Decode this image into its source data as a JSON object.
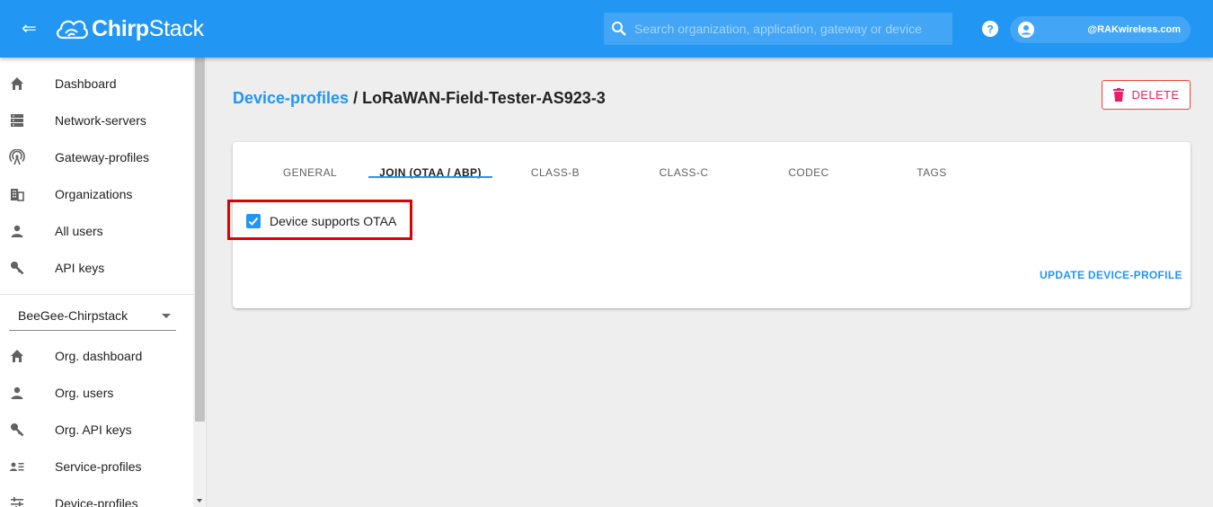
{
  "app": {
    "menu_icon": "collapse-menu-icon",
    "logo_bold": "Chirp",
    "logo_light": "Stack",
    "search_placeholder": "Search organization, application, gateway or device",
    "user_email": "@RAKwireless.com",
    "brand_color": "#2196f3"
  },
  "sidebar": {
    "items": [
      {
        "label": "Dashboard",
        "icon": "home-icon"
      },
      {
        "label": "Network-servers",
        "icon": "server-icon"
      },
      {
        "label": "Gateway-profiles",
        "icon": "antenna-icon"
      },
      {
        "label": "Organizations",
        "icon": "building-icon"
      },
      {
        "label": "All users",
        "icon": "user-icon"
      },
      {
        "label": "API keys",
        "icon": "key-icon"
      }
    ],
    "org_selected": "BeeGee-Chirpstack",
    "org_items": [
      {
        "label": "Org. dashboard",
        "icon": "home-icon"
      },
      {
        "label": "Org. users",
        "icon": "user-icon"
      },
      {
        "label": "Org. API keys",
        "icon": "key-icon"
      },
      {
        "label": "Service-profiles",
        "icon": "service-profile-icon"
      },
      {
        "label": "Device-profiles",
        "icon": "tune-icon"
      }
    ]
  },
  "main": {
    "breadcrumb_link": "Device-profiles",
    "breadcrumb_sep": "/",
    "breadcrumb_current": "LoRaWAN-Field-Tester-AS923-3",
    "delete_label": "DELETE",
    "delete_color": "#e91e63",
    "tabs": [
      {
        "label": "GENERAL",
        "active": false
      },
      {
        "label": "JOIN (OTAA / ABP)",
        "active": true
      },
      {
        "label": "CLASS-B",
        "active": false
      },
      {
        "label": "CLASS-C",
        "active": false
      },
      {
        "label": "CODEC",
        "active": false
      },
      {
        "label": "TAGS",
        "active": false
      }
    ],
    "otaa_checkbox_label": "Device supports OTAA",
    "otaa_checked": true,
    "update_label": "UPDATE DEVICE-PROFILE",
    "highlight_color": "#e00000"
  }
}
